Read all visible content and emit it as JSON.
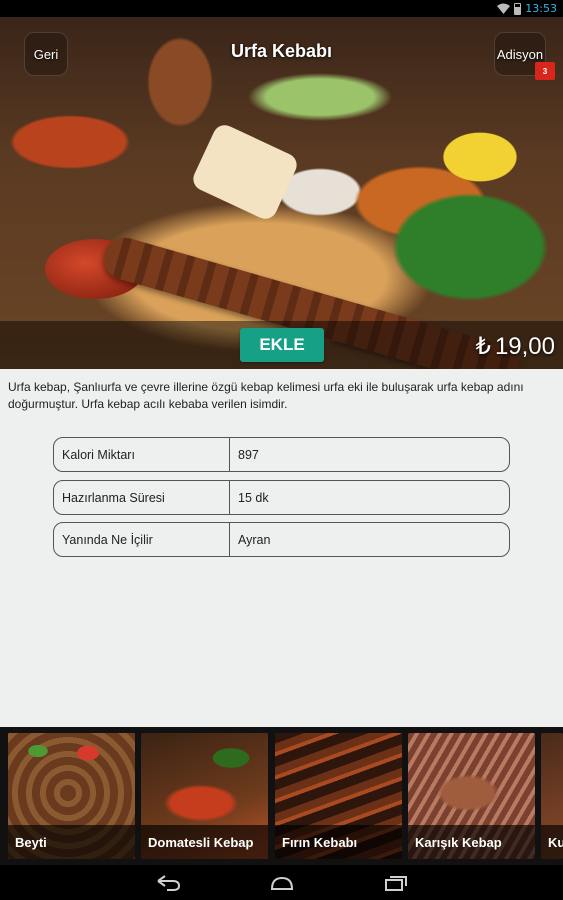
{
  "status_bar": {
    "time": "13:53"
  },
  "header": {
    "title": "Urfa Kebabı",
    "back_label": "Geri",
    "bill_label": "Adisyon",
    "bill_count": "3"
  },
  "product": {
    "add_label": "EKLE",
    "currency_symbol": "₺",
    "price": "19,00",
    "description": " Urfa kebap, Şanlıurfa ve çevre illerine özgü kebap kelimesi urfa eki ile buluşarak urfa kebap adını doğurmuştur. Urfa kebap acılı kebaba verilen isimdir.",
    "details": [
      {
        "label": "Kalori Miktarı",
        "value": "897"
      },
      {
        "label": "Hazırlanma Süresi",
        "value": "15 dk"
      },
      {
        "label": "Yanında Ne İçilir",
        "value": "Ayran"
      }
    ]
  },
  "carousel": {
    "items": [
      {
        "label": "Beyti"
      },
      {
        "label": "Domatesli Kebap"
      },
      {
        "label": "Fırın Kebabı"
      },
      {
        "label": "Karışık Kebap"
      },
      {
        "label": "Ku"
      }
    ]
  },
  "colors": {
    "accent": "#16a085",
    "badge": "#d9261c",
    "clock": "#33b5e5",
    "content_bg": "#edf0ef"
  }
}
